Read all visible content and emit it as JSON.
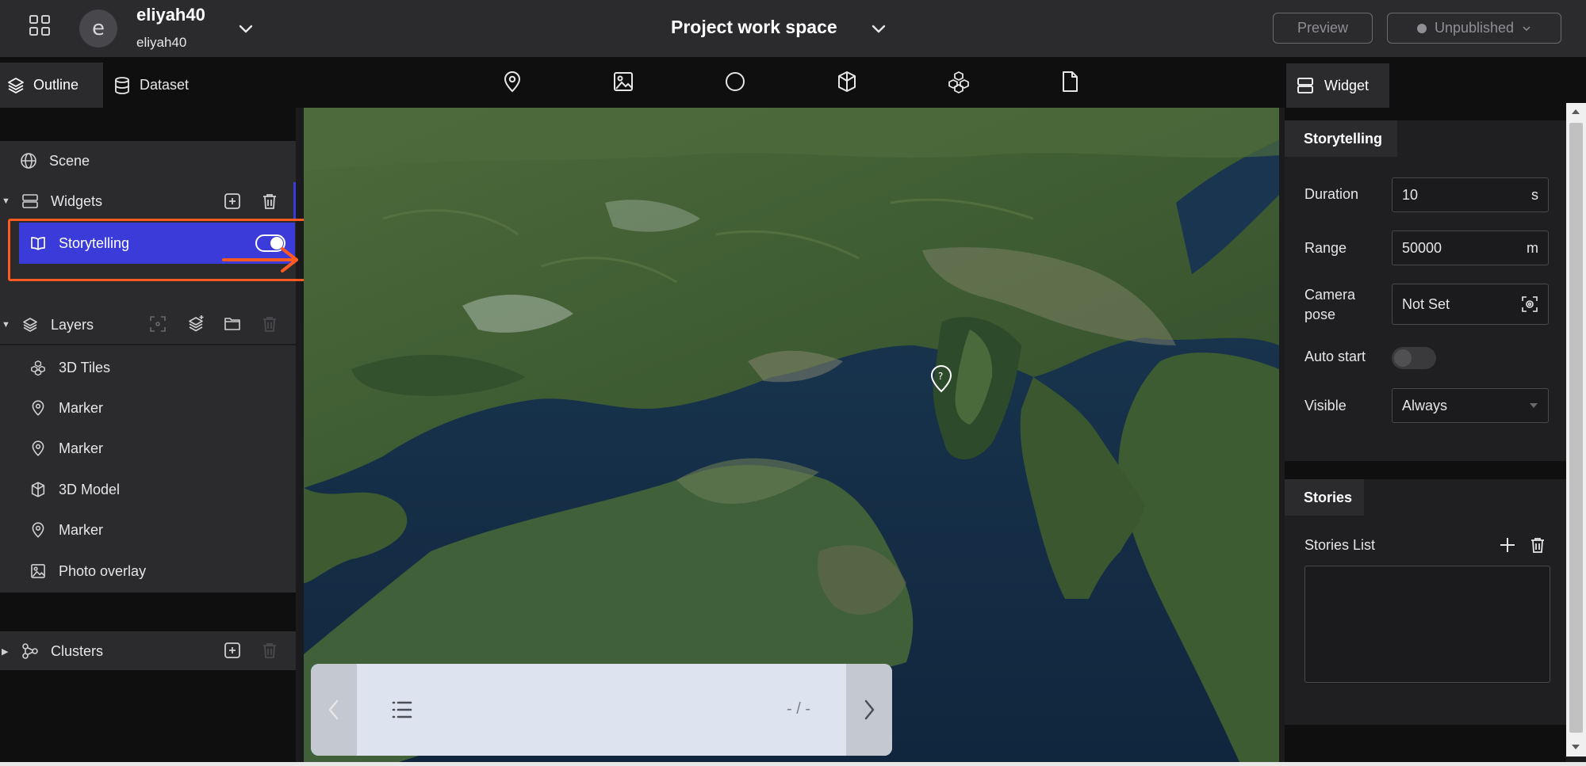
{
  "header": {
    "avatar_letter": "e",
    "user_name": "eliyah40",
    "user_sub": "eliyah40",
    "project_title": "Project work space",
    "preview_label": "Preview",
    "publish_label": "Unpublished"
  },
  "left_tabs": {
    "outline": "Outline",
    "dataset": "Dataset"
  },
  "toolbar": {
    "icons": [
      "marker-icon",
      "image-icon",
      "circle-icon",
      "3d-model-icon",
      "3d-tiles-icon",
      "file-icon"
    ]
  },
  "outline": {
    "scene": "Scene",
    "widgets": "Widgets",
    "storytelling": "Storytelling",
    "layers": "Layers",
    "layer_items": [
      "3D Tiles",
      "Marker",
      "Marker",
      "3D Model",
      "Marker",
      "Photo overlay"
    ],
    "clusters": "Clusters"
  },
  "story_panel": {
    "page": "- / -"
  },
  "widget_panel": {
    "tab": "Widget",
    "storytelling_header": "Storytelling",
    "duration_label": "Duration",
    "duration_value": "10",
    "duration_unit": "s",
    "range_label": "Range",
    "range_value": "50000",
    "range_unit": "m",
    "camera_label_1": "Camera",
    "camera_label_2": "pose",
    "camera_value": "Not Set",
    "auto_start_label": "Auto start",
    "auto_start_on": false,
    "visible_label": "Visible",
    "visible_value": "Always",
    "stories_header": "Stories",
    "stories_list_label": "Stories List"
  },
  "colors": {
    "accent": "#3b3bd9",
    "highlight": "#ff5a1f",
    "panel": "#2b2b2e",
    "background": "#0f0f10"
  }
}
